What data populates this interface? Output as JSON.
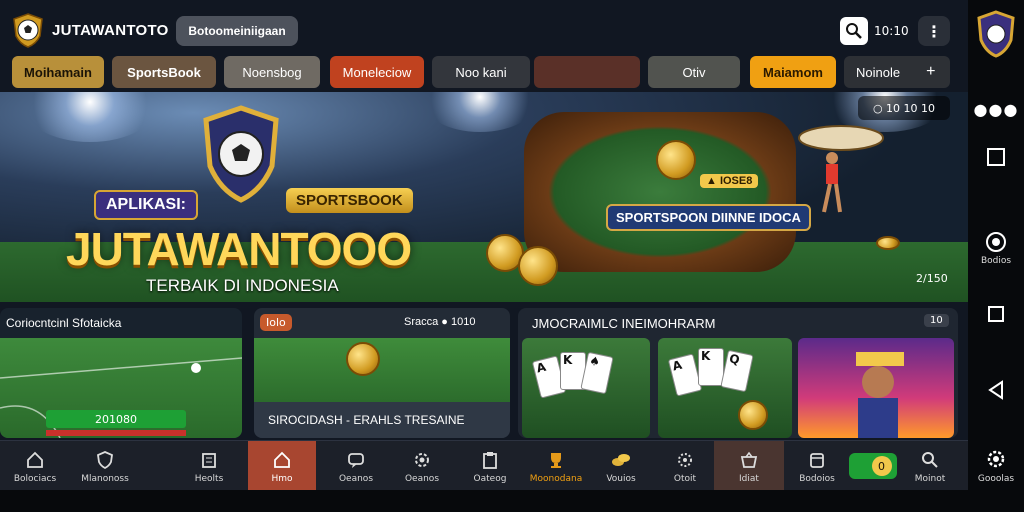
{
  "header": {
    "brand": "JUTAWANTOTO",
    "search_value": "Botoomeiniigaan",
    "search_button_text": "10:10",
    "menu_glyph": "⋮"
  },
  "chips": [
    {
      "label": "Moihamain",
      "color": "#b8903a"
    },
    {
      "label": "SportsBook",
      "color": "#6b5540"
    },
    {
      "label": "Noensbog",
      "color": "#6f6a63"
    },
    {
      "label": "Moneleciow",
      "color": "#c0421f"
    },
    {
      "label": "Noo kani",
      "color": "#33363c"
    },
    {
      "label": "",
      "color": "#5a3028"
    },
    {
      "label": "Otiv",
      "color": "#51534f"
    },
    {
      "label": "Maiamom",
      "color": "#f0a012"
    },
    {
      "label": "Noinole",
      "color": "#2d3035"
    }
  ],
  "hero": {
    "badge_left": "APLIKASI:",
    "badge_right": "SPORTSBOOK",
    "title": "JUTAWANTOOO",
    "subtitle": "TERBAIK DI INDONESIA",
    "banner": "SPORTSPOON DIINNE IDOCA",
    "small_banner": "▲ IOSE8",
    "controls": "○ 10 10 10",
    "counter": "2/150"
  },
  "panels": {
    "left": {
      "title": "Coriocntcinl Sfotaicka",
      "meter": "201080"
    },
    "middle": {
      "tag": "Iolo",
      "header": "Sracca ● 1010",
      "footer": "SIROCIDASH - ERAHLS TRESAINE"
    },
    "right": {
      "header": "JMOCRAIMLC INEIMOHRARM",
      "badge": "10"
    }
  },
  "nav": [
    {
      "label": "Bolociacs",
      "icon": "home-icon"
    },
    {
      "label": "Mlanonoss",
      "icon": "shield-icon"
    },
    {
      "label": "Heolts",
      "icon": "building-icon"
    },
    {
      "label": "Hmo",
      "icon": "house-icon"
    },
    {
      "label": "Oeanos",
      "icon": "chat-icon"
    },
    {
      "label": "Oeanos",
      "icon": "gear-icon"
    },
    {
      "label": "Oateog",
      "icon": "clipboard-icon"
    },
    {
      "label": "Moonodana",
      "icon": "trophy-icon"
    },
    {
      "label": "Vouios",
      "icon": "coins-icon"
    },
    {
      "label": "Otoit",
      "icon": "settings-icon"
    },
    {
      "label": "Idiat",
      "icon": "basket-icon"
    },
    {
      "label": "Bodoios",
      "icon": "card-icon"
    },
    {
      "label": "",
      "icon": "toggle-icon"
    },
    {
      "label": "Moinot",
      "icon": "search-icon"
    }
  ],
  "rail": {
    "items": [
      {
        "label": ""
      },
      {
        "label": ""
      },
      {
        "label": "Bodios"
      },
      {
        "label": ""
      },
      {
        "label": ""
      },
      {
        "label": "Gooolas"
      }
    ]
  },
  "colors": {
    "accent": "#f0a012",
    "brand_gold": "#ffd75a",
    "active_nav": "#a84630"
  }
}
